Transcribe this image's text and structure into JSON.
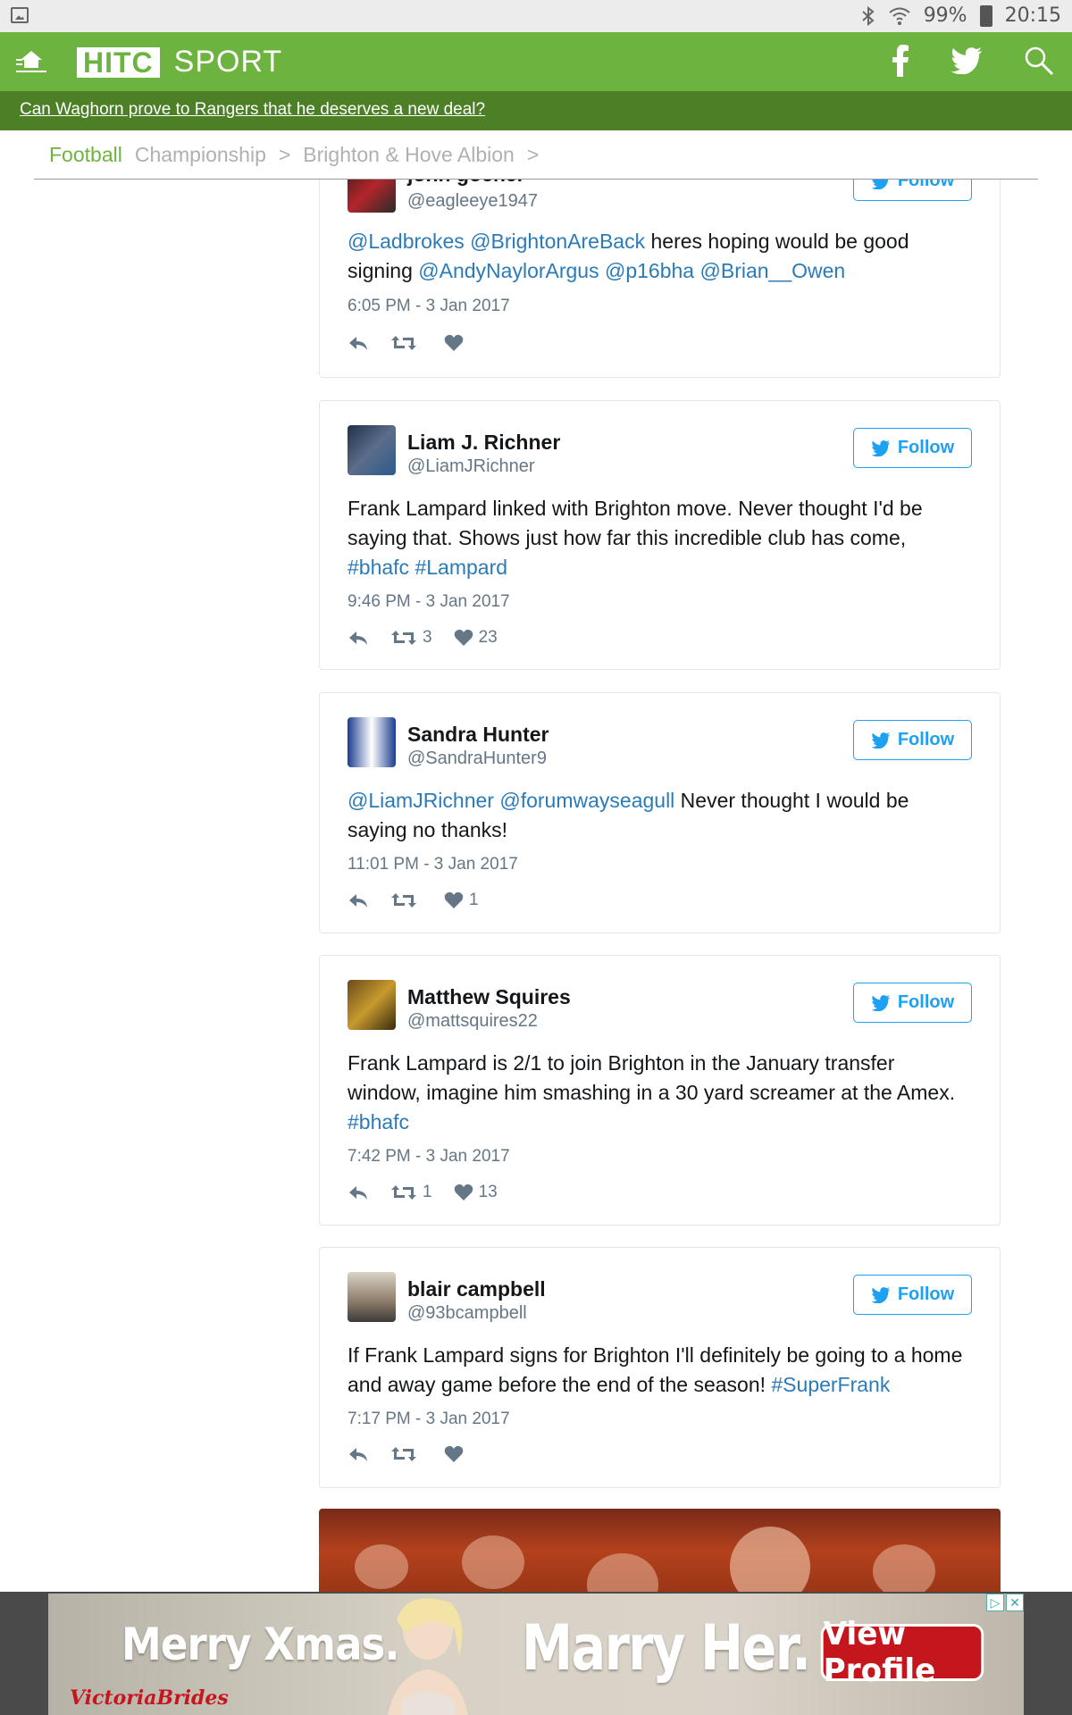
{
  "status_bar": {
    "battery": "99%",
    "time": "20:15"
  },
  "header": {
    "logo_box": "HITC",
    "logo_text": "SPORT",
    "brand_color": "#6db33f"
  },
  "promo": {
    "text": "Can Waghorn prove to Rangers that he deserves a new deal?"
  },
  "breadcrumb": {
    "items": [
      "Football",
      "Championship",
      "Brighton & Hove Albion"
    ],
    "separator": ">"
  },
  "follow_label": "Follow",
  "tweets": [
    {
      "name": "john gocher",
      "handle": "@eagleeye1947",
      "text_parts": [
        {
          "t": "@Ladbrokes",
          "link": true
        },
        {
          "t": " ",
          "link": false
        },
        {
          "t": "@BrightonAreBack",
          "link": true
        },
        {
          "t": " heres hoping would be good signing ",
          "link": false
        },
        {
          "t": "@AndyNaylorArgus",
          "link": true
        },
        {
          "t": " ",
          "link": false
        },
        {
          "t": "@p16bha",
          "link": true
        },
        {
          "t": " ",
          "link": false
        },
        {
          "t": "@Brian__Owen",
          "link": true
        }
      ],
      "time": "6:05 PM - 3 Jan 2017",
      "retweets": "",
      "likes": ""
    },
    {
      "name": "Liam J. Richner",
      "handle": "@LiamJRichner",
      "text_parts": [
        {
          "t": "Frank Lampard linked with Brighton move. Never thought I'd be saying that. Shows just how far this incredible club has come, ",
          "link": false
        },
        {
          "t": "#bhafc",
          "link": true
        },
        {
          "t": " ",
          "link": false
        },
        {
          "t": "#Lampard",
          "link": true
        }
      ],
      "time": "9:46 PM - 3 Jan 2017",
      "retweets": "3",
      "likes": "23"
    },
    {
      "name": "Sandra Hunter",
      "handle": "@SandraHunter9",
      "text_parts": [
        {
          "t": "@LiamJRichner",
          "link": true
        },
        {
          "t": " ",
          "link": false
        },
        {
          "t": "@forumwayseagull",
          "link": true
        },
        {
          "t": " Never thought I would be saying no thanks!",
          "link": false
        }
      ],
      "time": "11:01 PM - 3 Jan 2017",
      "retweets": "",
      "likes": "1"
    },
    {
      "name": "Matthew Squires",
      "handle": "@mattsquires22",
      "text_parts": [
        {
          "t": "Frank Lampard is 2/1 to join Brighton in the January transfer window, imagine him smashing in a 30 yard screamer at the Amex. ",
          "link": false
        },
        {
          "t": "#bhafc",
          "link": true
        }
      ],
      "time": "7:42 PM - 3 Jan 2017",
      "retweets": "1",
      "likes": "13"
    },
    {
      "name": "blair campbell",
      "handle": "@93bcampbell",
      "text_parts": [
        {
          "t": "If Frank Lampard signs for Brighton I'll definitely be going to a home and away game before the end of the season! ",
          "link": false
        },
        {
          "t": "#SuperFrank",
          "link": true
        }
      ],
      "time": "7:17 PM - 3 Jan 2017",
      "retweets": "",
      "likes": ""
    }
  ],
  "ad": {
    "left_text": "Merry Xmas.",
    "center_text": "Marry Her.",
    "button": "View Profile",
    "brand": "VictoriaBrides"
  }
}
